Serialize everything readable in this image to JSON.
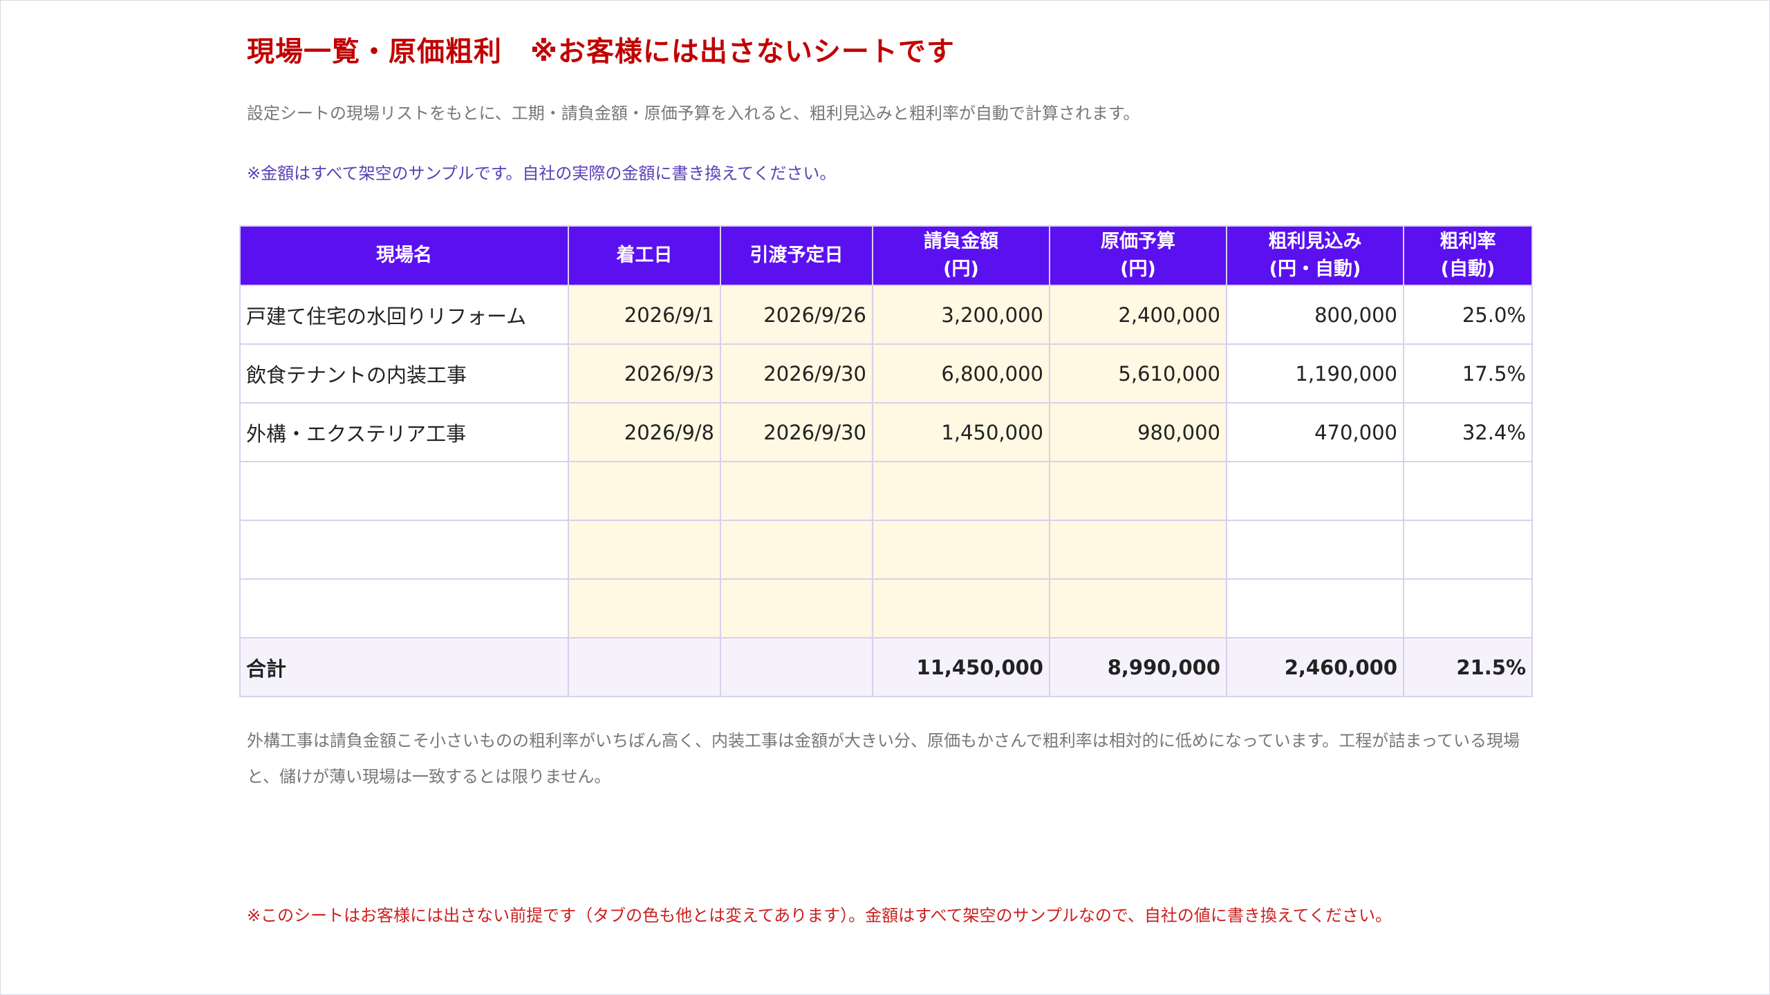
{
  "page": {
    "title": "現場一覧・原価粗利　※お客様には出さないシートです",
    "description": "設定シートの現場リストをもとに、工期・請負金額・原価予算を入れると、粗利見込みと粗利率が自動で計算されます。",
    "sample_note": "※金額はすべて架空のサンプルです。自社の実際の金額に書き換えてください。"
  },
  "table": {
    "headers": [
      {
        "line1": "現場名",
        "line2": ""
      },
      {
        "line1": "着工日",
        "line2": ""
      },
      {
        "line1": "引渡予定日",
        "line2": ""
      },
      {
        "line1": "請負金額",
        "line2": "(円)"
      },
      {
        "line1": "原価予算",
        "line2": "(円)"
      },
      {
        "line1": "粗利見込み",
        "line2": "(円・自動)"
      },
      {
        "line1": "粗利率",
        "line2": "(自動)"
      }
    ],
    "rows": [
      {
        "name": "戸建て住宅の水回りリフォーム",
        "start": "2026/9/1",
        "delivery": "2026/9/26",
        "contract": "3,200,000",
        "cost": "2,400,000",
        "profit": "800,000",
        "rate": "25.0%"
      },
      {
        "name": "飲食テナントの内装工事",
        "start": "2026/9/3",
        "delivery": "2026/9/30",
        "contract": "6,800,000",
        "cost": "5,610,000",
        "profit": "1,190,000",
        "rate": "17.5%"
      },
      {
        "name": "外構・エクステリア工事",
        "start": "2026/9/8",
        "delivery": "2026/9/30",
        "contract": "1,450,000",
        "cost": "980,000",
        "profit": "470,000",
        "rate": "32.4%"
      },
      {
        "name": "",
        "start": "",
        "delivery": "",
        "contract": "",
        "cost": "",
        "profit": "",
        "rate": ""
      },
      {
        "name": "",
        "start": "",
        "delivery": "",
        "contract": "",
        "cost": "",
        "profit": "",
        "rate": ""
      },
      {
        "name": "",
        "start": "",
        "delivery": "",
        "contract": "",
        "cost": "",
        "profit": "",
        "rate": ""
      }
    ],
    "total": {
      "label": "合計",
      "contract": "11,450,000",
      "cost": "8,990,000",
      "profit": "2,460,000",
      "rate": "21.5%"
    }
  },
  "analysis": "外構工事は請負金額こそ小さいものの粗利率がいちばん高く、内装工事は金額が大きい分、原価もかさんで粗利率は相対的に低めになっています。工程が詰まっている現場と、儲けが薄い現場は一致するとは限りません。",
  "footnote": "※このシートはお客様には出さない前提です（タブの色も他とは変えてあります）。金額はすべて架空のサンプルなので、自社の値に書き換えてください。",
  "colors": {
    "title": "#c00000",
    "header_bg": "#5b10f0",
    "input_cell_bg": "#fff8e3",
    "input_text": "#2f7fc1",
    "note_purple": "#5a3fb8",
    "footnote_red": "#cc1f1f"
  }
}
